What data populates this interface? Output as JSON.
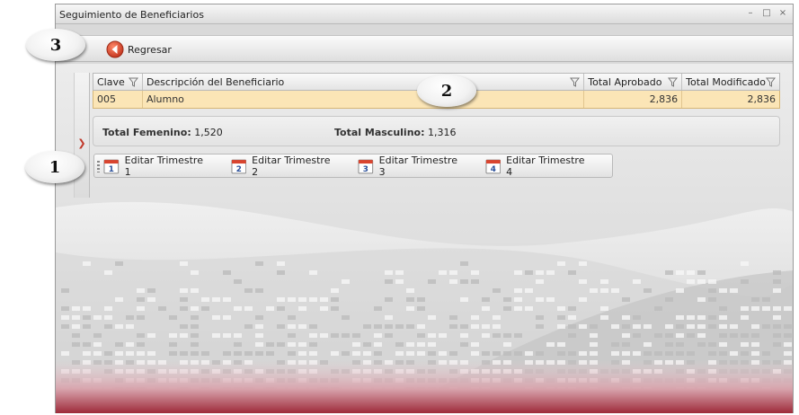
{
  "window": {
    "title": "Seguimiento de Beneficiarios"
  },
  "toolbar": {
    "back_label": "Regresar"
  },
  "grid": {
    "columns": [
      "Clave",
      "Descripción del Beneficiario",
      "Total Aprobado",
      "Total Modificado"
    ],
    "rows": [
      {
        "clave": "005",
        "descripcion": "Alumno",
        "aprobado": "2,836",
        "modificado": "2,836"
      }
    ]
  },
  "totals": {
    "femenino_label": "Total Femenino:",
    "femenino_value": "1,520",
    "masculino_label": "Total Masculino:",
    "masculino_value": "1,316"
  },
  "trimestres": [
    {
      "num": "1",
      "label": "Editar Trimestre 1"
    },
    {
      "num": "2",
      "label": "Editar Trimestre 2"
    },
    {
      "num": "3",
      "label": "Editar Trimestre 3"
    },
    {
      "num": "4",
      "label": "Editar Trimestre 4"
    }
  ],
  "markers": [
    "1",
    "2",
    "3"
  ],
  "colors": {
    "selected_row": "#fbe5b6",
    "accent_red": "#c0392b"
  }
}
